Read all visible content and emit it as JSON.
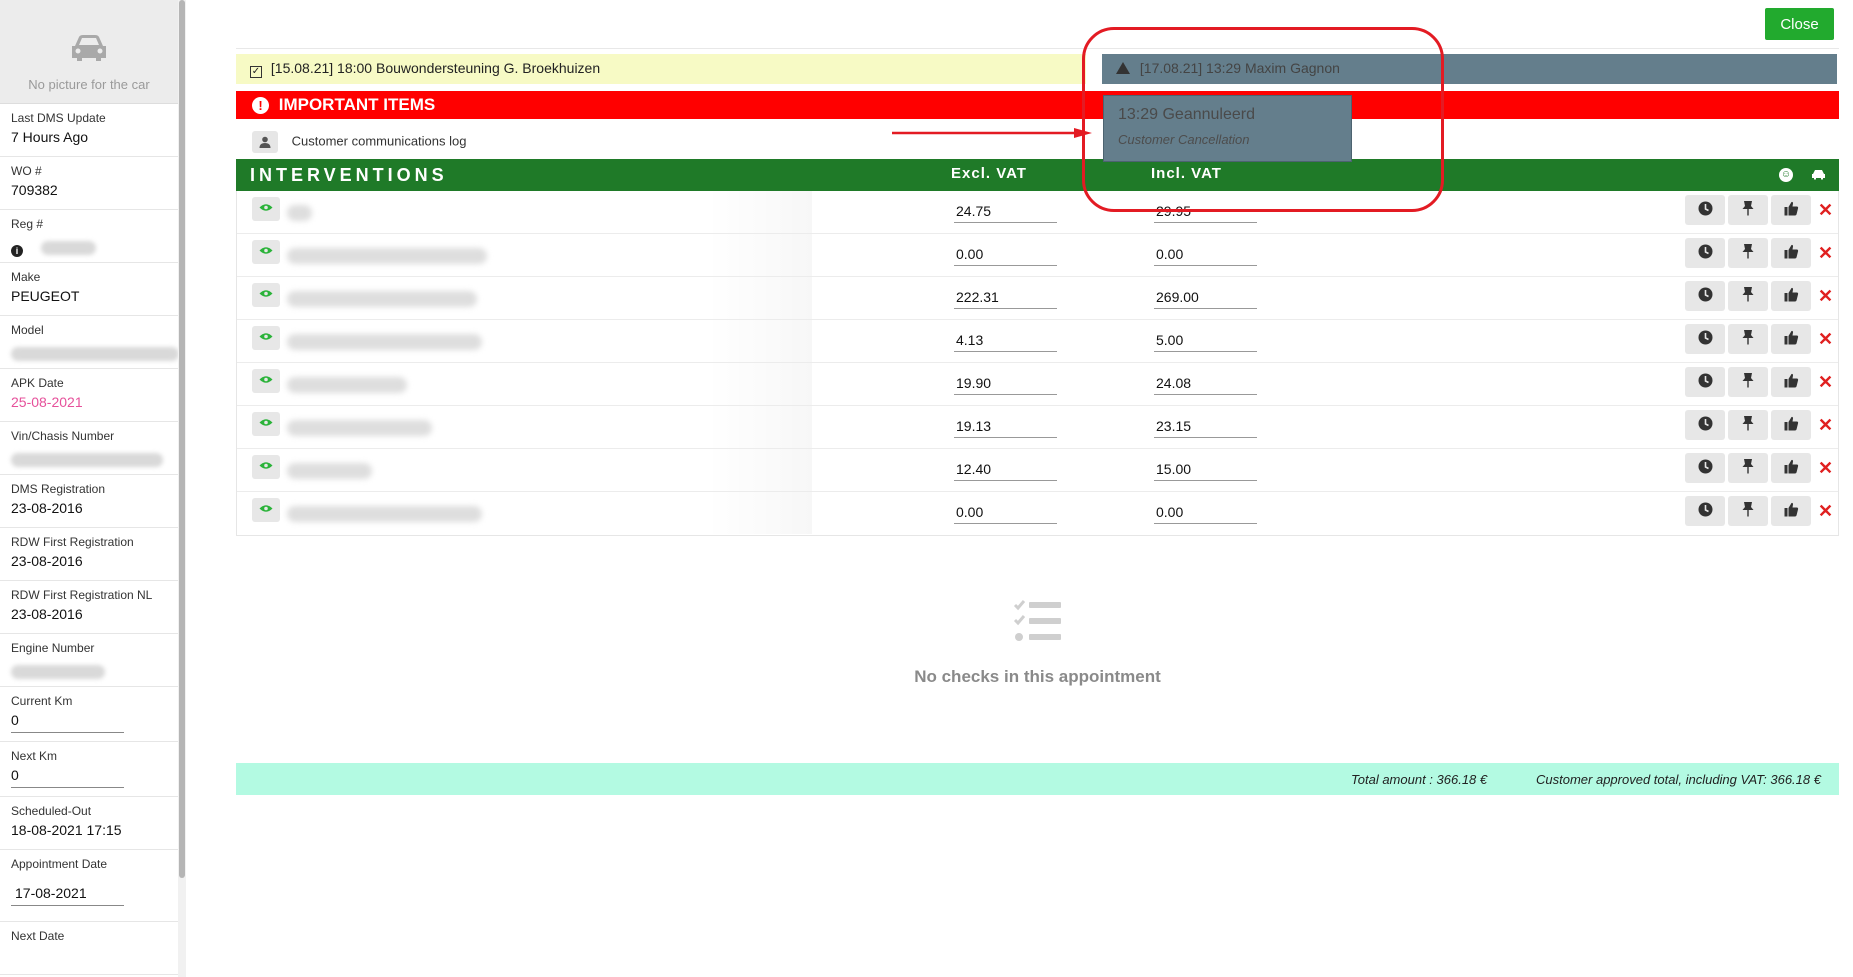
{
  "sidebar": {
    "photo_text": "No picture for the car",
    "fields": [
      {
        "label": "Last DMS Update",
        "value": "7 Hours Ago"
      },
      {
        "label": "WO #",
        "value": "709382"
      },
      {
        "label": "Reg #",
        "value": ""
      },
      {
        "label": "Make",
        "value": "PEUGEOT"
      },
      {
        "label": "Model",
        "value": ""
      },
      {
        "label": "APK Date",
        "value": "25-08-2021"
      },
      {
        "label": "Vin/Chasis Number",
        "value": ""
      },
      {
        "label": "DMS Registration",
        "value": "23-08-2016"
      },
      {
        "label": "RDW First Registration",
        "value": "23-08-2016"
      },
      {
        "label": "RDW First Registration NL",
        "value": "23-08-2016"
      },
      {
        "label": "Engine Number",
        "value": ""
      },
      {
        "label": "Current Km",
        "value": "0"
      },
      {
        "label": "Next Km",
        "value": "0"
      },
      {
        "label": "Scheduled-Out",
        "value": "18-08-2021 17:15"
      },
      {
        "label": "Appointment Date",
        "value": "17-08-2021"
      },
      {
        "label": "Next Date",
        "value": ""
      }
    ]
  },
  "header": {
    "close_label": "Close"
  },
  "notes": {
    "yellow_date": "[15.08.21] 18:00",
    "yellow_text": "Bouwondersteuning G. Broekhuizen",
    "grey_text": "[17.08.21] 13:29 Maxim Gagnon"
  },
  "important": {
    "title": "IMPORTANT ITEMS",
    "comm_label": "Customer communications log"
  },
  "interventions": {
    "title": "INTERVENTIONS",
    "col_excl": "Excl. VAT",
    "col_incl": "Incl. VAT",
    "rows": [
      {
        "excl": "24.75",
        "incl": "29.95"
      },
      {
        "excl": "0.00",
        "incl": "0.00"
      },
      {
        "excl": "222.31",
        "incl": "269.00"
      },
      {
        "excl": "4.13",
        "incl": "5.00"
      },
      {
        "excl": "19.90",
        "incl": "24.08"
      },
      {
        "excl": "19.13",
        "incl": "23.15"
      },
      {
        "excl": "12.40",
        "incl": "15.00"
      },
      {
        "excl": "0.00",
        "incl": "0.00"
      }
    ]
  },
  "checks": {
    "empty_text": "No checks in this appointment"
  },
  "totals": {
    "total_amount": "Total amount : 366.18 €",
    "approved_total": "Customer approved total, including VAT: 366.18 €"
  },
  "popover": {
    "title": "13:29 Geannuleerd",
    "subtitle": "Customer Cancellation"
  },
  "colors": {
    "green": "#1f7a28",
    "red": "#ff0000",
    "mint": "#b3fae2",
    "yellow": "#f7fac5",
    "slate": "#647e8c",
    "pink": "#e6519b",
    "annotation": "#e31b23"
  }
}
